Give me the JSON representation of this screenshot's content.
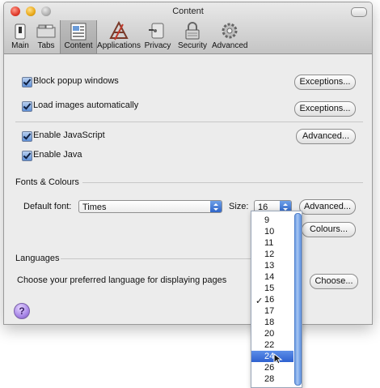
{
  "window": {
    "title": "Content"
  },
  "toolbar": {
    "items": [
      {
        "label": "Main",
        "icon": "switch-icon"
      },
      {
        "label": "Tabs",
        "icon": "tabs-icon"
      },
      {
        "label": "Content",
        "icon": "content-icon",
        "selected": true
      },
      {
        "label": "Applications",
        "icon": "applications-icon"
      },
      {
        "label": "Privacy",
        "icon": "privacy-icon"
      },
      {
        "label": "Security",
        "icon": "lock-icon"
      },
      {
        "label": "Advanced",
        "icon": "gear-icon"
      }
    ]
  },
  "content": {
    "block_popups": {
      "label": "Block popup windows",
      "checked": true,
      "button": "Exceptions..."
    },
    "load_images": {
      "label": "Load images automatically",
      "checked": true,
      "button": "Exceptions..."
    },
    "enable_js": {
      "label": "Enable JavaScript",
      "checked": true,
      "button": "Advanced..."
    },
    "enable_java": {
      "label": "Enable Java",
      "checked": true
    }
  },
  "fonts": {
    "heading": "Fonts & Colours",
    "default_font_label": "Default font:",
    "default_font_value": "Times",
    "size_label": "Size:",
    "size_value": "16",
    "advanced_button": "Advanced...",
    "colours_button": "Colours..."
  },
  "languages": {
    "heading": "Languages",
    "description": "Choose your preferred language for displaying pages",
    "choose_button": "Choose..."
  },
  "help": {
    "label": "?"
  },
  "size_dropdown": {
    "options": [
      "9",
      "10",
      "11",
      "12",
      "13",
      "14",
      "15",
      "16",
      "17",
      "18",
      "20",
      "22",
      "24",
      "26",
      "28"
    ],
    "checked": "16",
    "highlighted": "24",
    "check_mark": "✓"
  },
  "colors": {
    "accent": "#2e61d0",
    "window_bg": "#ececec"
  }
}
